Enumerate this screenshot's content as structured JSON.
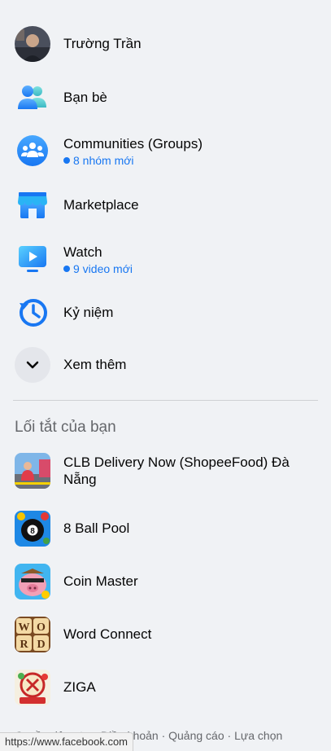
{
  "nav": {
    "profile": {
      "name": "Trường Trần"
    },
    "friends": {
      "label": "Bạn bè"
    },
    "groups": {
      "label": "Communities (Groups)",
      "sub": "8 nhóm mới"
    },
    "marketplace": {
      "label": "Marketplace"
    },
    "watch": {
      "label": "Watch",
      "sub": "9 video mới"
    },
    "memories": {
      "label": "Kỷ niệm"
    },
    "see_more": {
      "label": "Xem thêm"
    }
  },
  "shortcuts": {
    "title": "Lối tắt của bạn",
    "items": [
      {
        "label": "CLB Delivery Now (ShopeeFood) Đà Nẵng",
        "icon": "group-thumbnail"
      },
      {
        "label": "8 Ball Pool",
        "icon": "8-ball-pool-icon"
      },
      {
        "label": "Coin Master",
        "icon": "coin-master-icon"
      },
      {
        "label": "Word Connect",
        "icon": "word-connect-icon"
      },
      {
        "label": "ZIGA",
        "icon": "ziga-icon"
      }
    ]
  },
  "footer": {
    "line1": "Quyền riêng tư · Điều khoản · Quảng cáo · Lựa chọn"
  },
  "status_bar": {
    "url": "https://www.facebook.com"
  },
  "colors": {
    "accent": "#1877f2",
    "background": "#f0f2f5",
    "secondary_text": "#65676b"
  }
}
